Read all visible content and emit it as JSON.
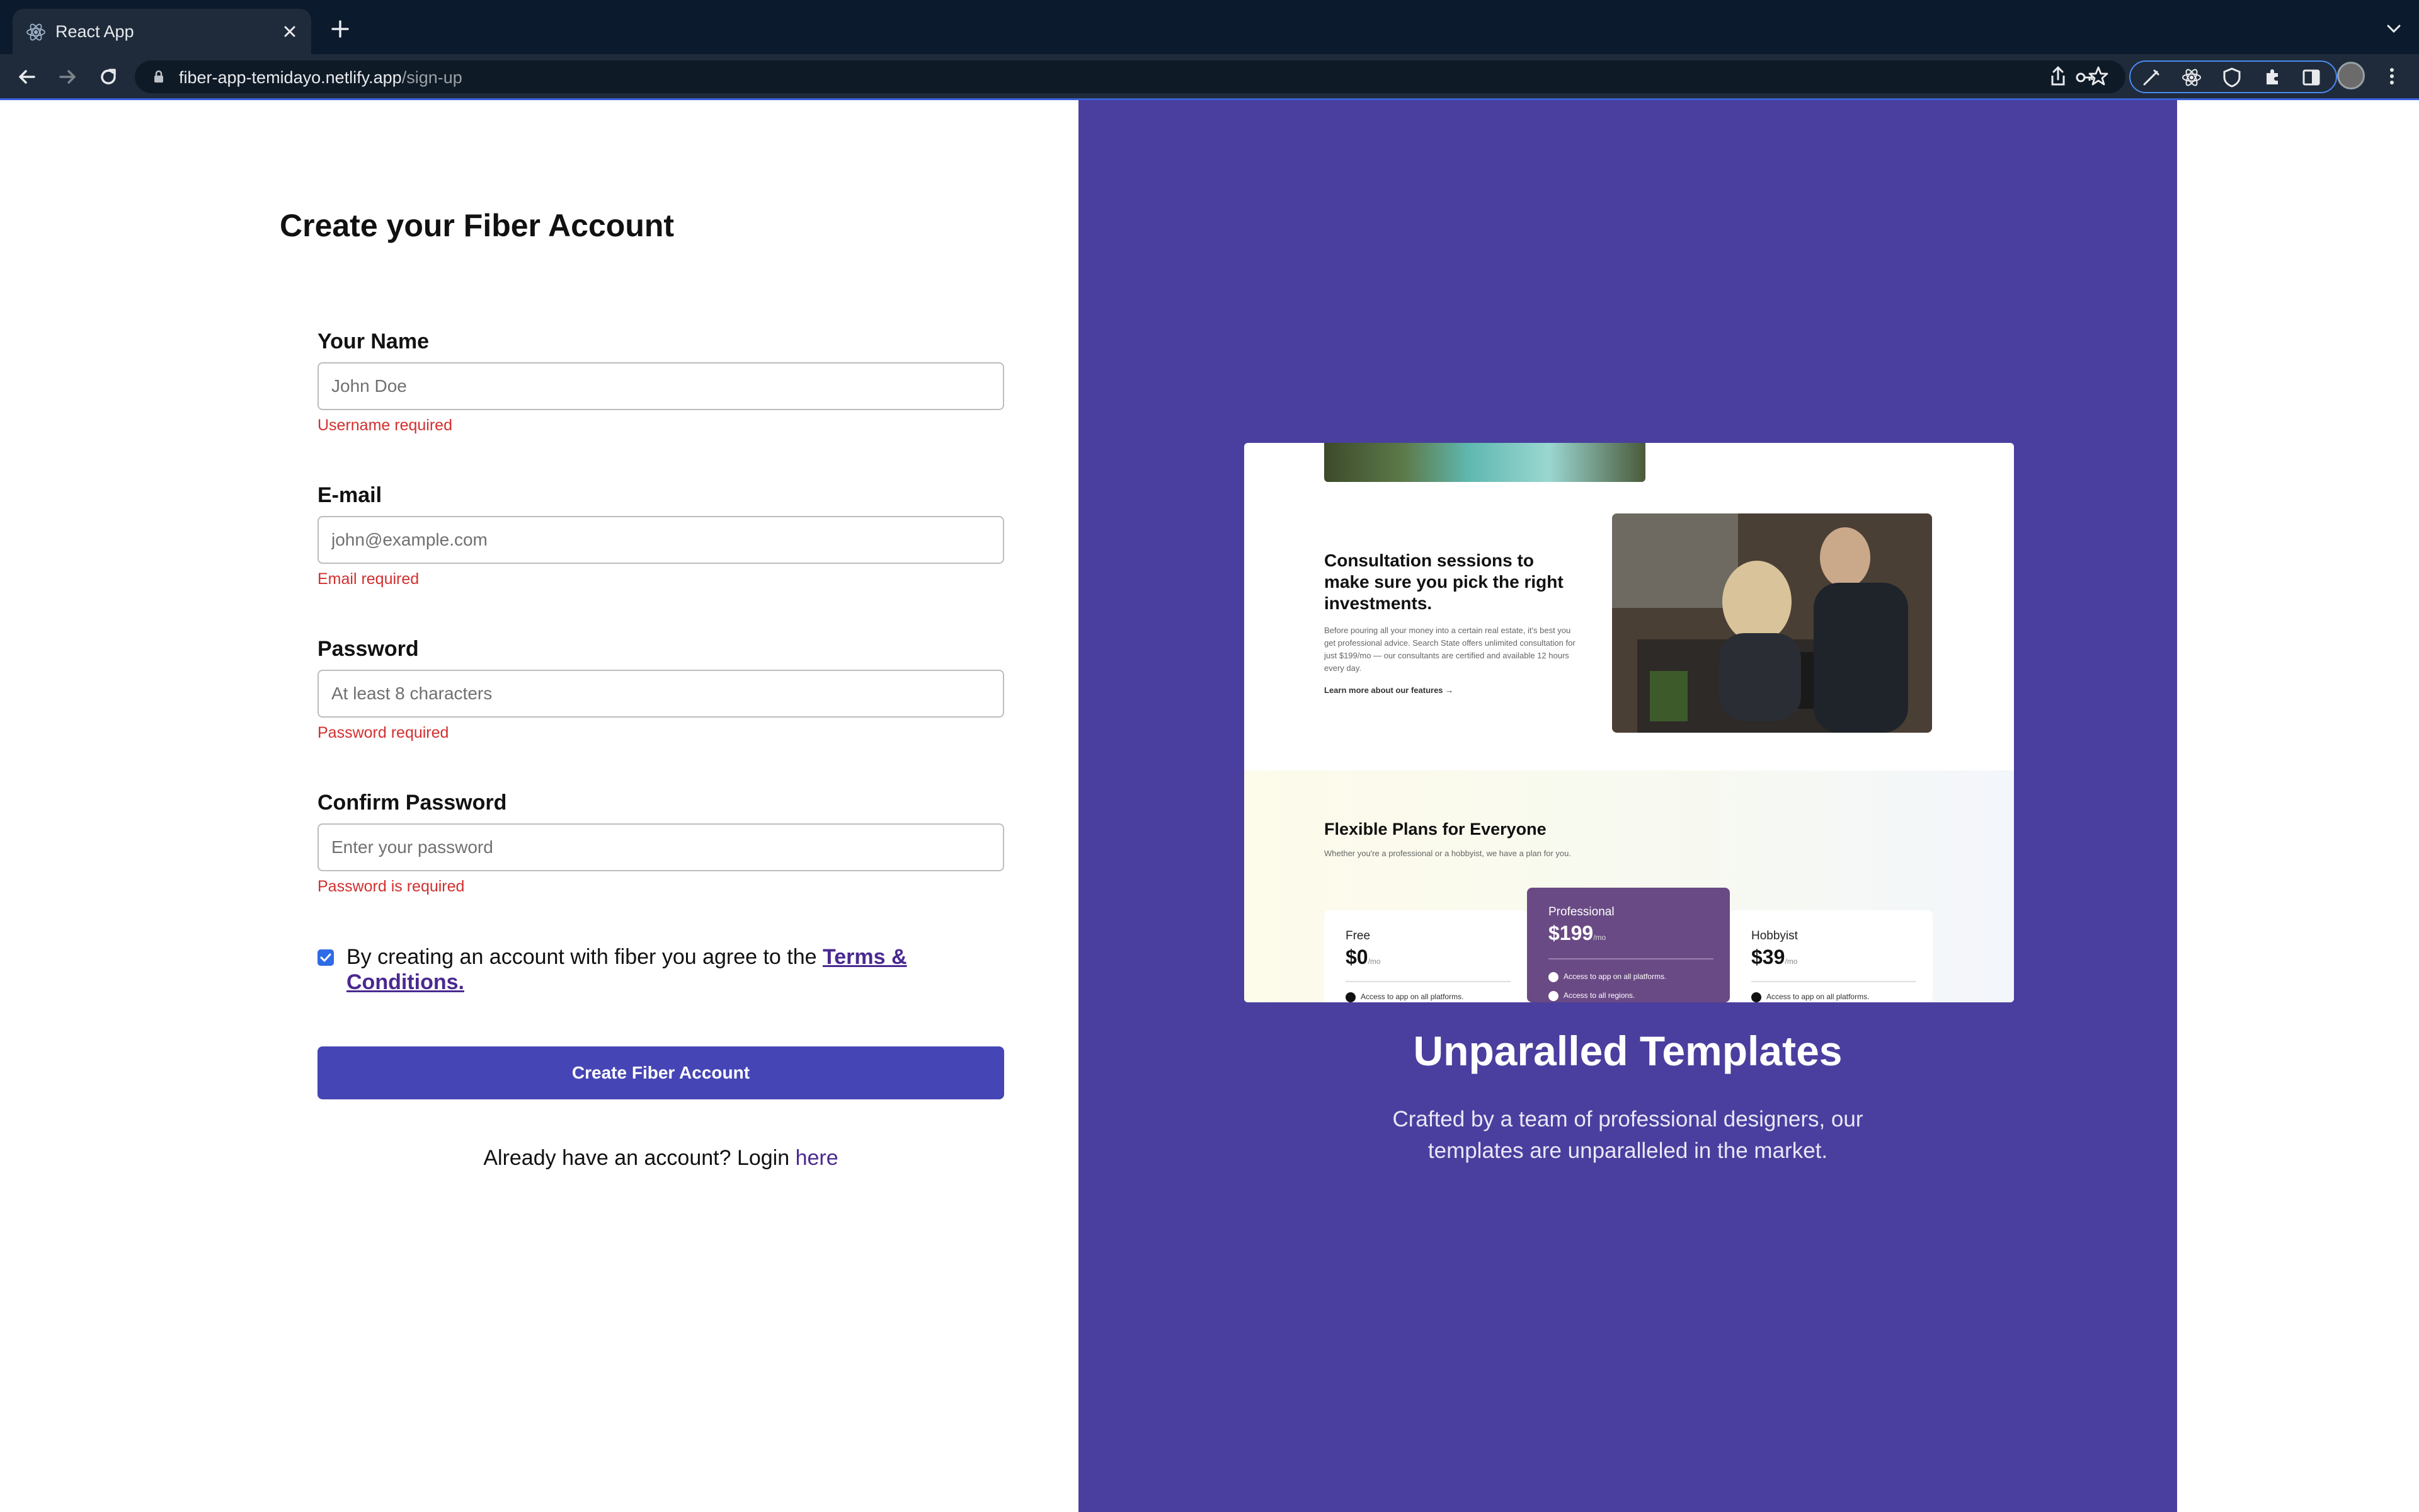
{
  "browser": {
    "tab_title": "React App",
    "url_host": "fiber-app-temidayo.netlify.app",
    "url_path": "/sign-up"
  },
  "form": {
    "title": "Create your Fiber Account",
    "name": {
      "label": "Your Name",
      "placeholder": "John Doe",
      "error": "Username required"
    },
    "email": {
      "label": "E-mail",
      "placeholder": "john@example.com",
      "error": "Email required"
    },
    "password": {
      "label": "Password",
      "placeholder": "At least 8 characters",
      "error": "Password required"
    },
    "confirm": {
      "label": "Confirm Password",
      "placeholder": "Enter your password",
      "error": "Password is required"
    },
    "agree_checked": true,
    "agree_text": "By creating an account with fiber you agree to the ",
    "agree_link": "Terms & Conditions.",
    "submit_label": "Create Fiber Account",
    "login_text": "Already have an account? Login ",
    "login_link": "here"
  },
  "preview": {
    "consult_title": "Consultation sessions to make sure you pick the right investments.",
    "consult_body": "Before pouring all your money into a certain real estate, it's best you get professional advice. Search State offers unlimited consultation for just $199/mo — our consultants are certified and available 12 hours every day.",
    "consult_link": "Learn more about our features →",
    "plans_title": "Flexible Plans for Everyone",
    "plans_sub": "Whether you're a professional or a hobbyist, we have a plan for you.",
    "plans": [
      {
        "name": "Free",
        "price": "$0",
        "unit": "/mo",
        "features": [
          "Access to app on all platforms."
        ]
      },
      {
        "name": "Professional",
        "price": "$199",
        "unit": "/mo",
        "features": [
          "Access to app on all platforms.",
          "Access to all regions."
        ]
      },
      {
        "name": "Hobbyist",
        "price": "$39",
        "unit": "/mo",
        "features": [
          "Access to app on all platforms."
        ]
      }
    ]
  },
  "hero": {
    "title": "Unparalled Templates",
    "subtitle": "Crafted by a team of professional designers, our templates are unparalleled in the market."
  },
  "colors": {
    "panel": "#4a3f9e",
    "button": "#4545b5",
    "error": "#d32f2f",
    "link": "#4a2990"
  }
}
